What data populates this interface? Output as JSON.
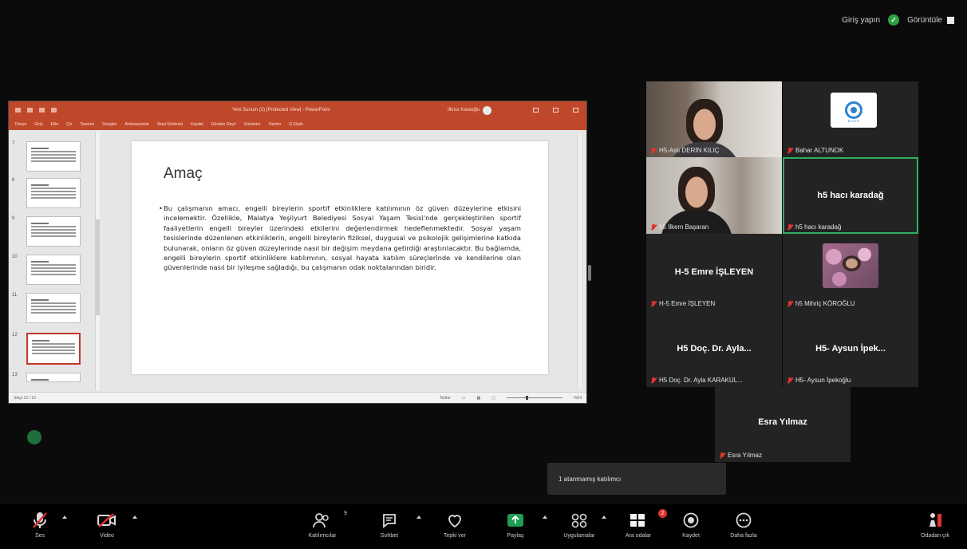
{
  "top": {
    "signin": "Giriş yapın",
    "view_label": "Görüntüle",
    "shield_mark": "✓"
  },
  "ppt": {
    "title": "Yeni Sunum (2) [Protected View]  -  PowerPoint",
    "user": "Ilknur Karaoğlu",
    "tabs": [
      "Dosya",
      "Giriş",
      "Ekle",
      "Çiz",
      "Tasarım",
      "Geçişler",
      "Animasyonlar",
      "Slayt Gösterisi",
      "Kaydet",
      "Gözden Geçir",
      "Görünüm",
      "Yardım",
      "Q  Söyle"
    ],
    "thumb_numbers": [
      "7",
      "8",
      "9",
      "10",
      "11",
      "12",
      "13"
    ],
    "status_left": "Slayt 12 / 13",
    "status_notes": "Notlar",
    "status_zoom": "%64",
    "slide_title": "Amaç",
    "slide_text": "Bu çalışmanın amacı, engelli bireylerin sportif etkinliklere katılımının öz güven düzeylerine etkisini incelemektir. Özellikle, Malatya Yeşilyurt Belediyesi Sosyal Yaşam Tesisi'nde gerçekleştirilen sportif faaliyetlerin engelli bireyler üzerindeki etkilerini değerlendirmek hedeflenmektedir. Sosyal yaşam tesislerinde düzenlenen etkinliklerin, engelli bireylerin fiziksel, duygusal ve psikolojik gelişimlerine katkıda bulunarak, onların öz güven düzeylerinde nasıl bir değişim meydana getirdiği araştırılacaktır. Bu bağlamda, engelli bireylerin sportif etkinliklere katılımının, sosyal hayata katılım süreçlerinde ve kendilerine olan güvenlerinde nasıl bir iyileşme sağladığı, bu çalışmanın odak noktalarından biridir."
  },
  "participants": [
    {
      "label": "H5-Aslı DERİN KILIÇ",
      "big": "",
      "type": "video-woman"
    },
    {
      "label": "Bahar ALTUNOK",
      "big": "",
      "type": "logo",
      "logo_text": "BİYAĞ"
    },
    {
      "label": "h5 İlkem Başaran",
      "big": "",
      "type": "video-woman2"
    },
    {
      "label": "h5 hacı karadağ",
      "big": "h5 hacı karadağ",
      "type": "name"
    },
    {
      "label": "H-5 Emre İŞLEYEN",
      "big": "H-5 Emre İŞLEYEN",
      "type": "name"
    },
    {
      "label": "h5 Mihriç KÖROĞLU",
      "big": "",
      "type": "photo"
    },
    {
      "label": "H5 Doç. Dr. Ayla KARAKUL...",
      "big": "H5  Doç. Dr. Ayla...",
      "type": "name"
    },
    {
      "label": "H5- Aysun İpekoğlu",
      "big": "H5- Aysun İpek...",
      "type": "name"
    },
    {
      "label": "Esra Yılmaz",
      "big": "Esra Yılmaz",
      "type": "name"
    }
  ],
  "notice": "1 atanmamış katılımcı",
  "toolbar": {
    "items": [
      {
        "name": "mute-button",
        "label": "Ses"
      },
      {
        "name": "video-button",
        "label": "Video"
      },
      {
        "name": "participants-button",
        "label": "Katılımcılar",
        "count": "9"
      },
      {
        "name": "chat-button",
        "label": "Sohbet"
      },
      {
        "name": "reactions-button",
        "label": "Tepki ver"
      },
      {
        "name": "share-button",
        "label": "Paylaş"
      },
      {
        "name": "apps-button",
        "label": "Uygulamalar"
      },
      {
        "name": "breakout-button",
        "label": "Ara odalar",
        "badge": "2"
      },
      {
        "name": "record-button",
        "label": "Kaydet"
      },
      {
        "name": "more-button",
        "label": "Daha fazla"
      },
      {
        "name": "leave-button",
        "label": "Odadan çık"
      }
    ]
  },
  "colors": {
    "ppt_accent": "#c0482a",
    "active_speaker": "#2fae63",
    "muted": "#e0332f",
    "share": "#1f9d55"
  }
}
